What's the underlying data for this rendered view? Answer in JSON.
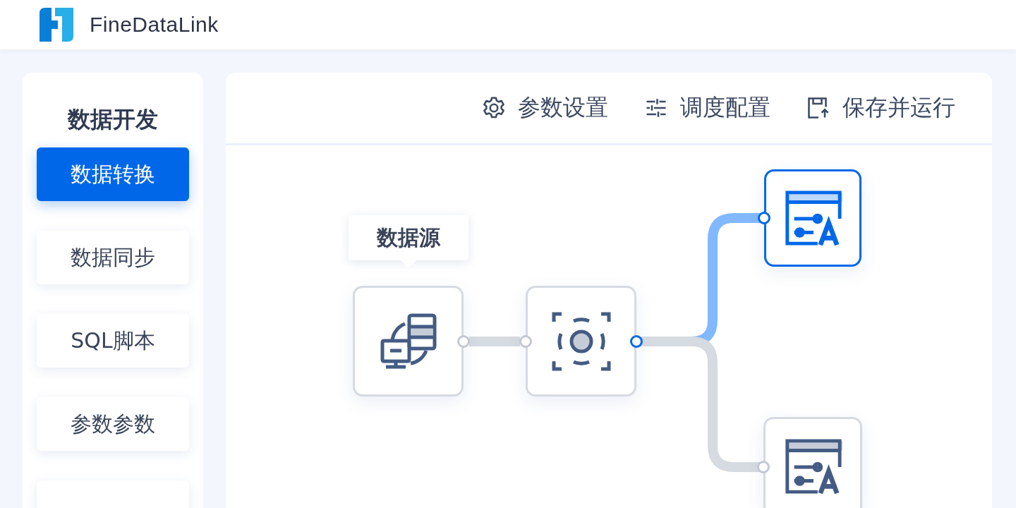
{
  "header": {
    "product_name": "FineDataLink"
  },
  "sidebar": {
    "title": "数据开发",
    "items": [
      {
        "label": "数据转换",
        "selected": true
      },
      {
        "label": "数据同步",
        "selected": false
      },
      {
        "label": "SQL脚本",
        "selected": false
      },
      {
        "label": "参数参数",
        "selected": false
      },
      {
        "selected": false
      }
    ]
  },
  "toolbar": {
    "buttons": [
      {
        "kind": "settings",
        "label": "参数设置"
      },
      {
        "kind": "schedule",
        "label": "调度配置"
      },
      {
        "kind": "save",
        "label": "保存并运行"
      }
    ]
  },
  "canvas": {
    "tooltip": "数据源",
    "nodes": [
      {
        "kind": "source",
        "selected": false
      },
      {
        "kind": "transform",
        "selected": false
      },
      {
        "kind": "output",
        "selected": true
      },
      {
        "kind": "output",
        "selected": false
      }
    ],
    "edges": [
      {
        "active": false
      },
      {
        "active": true
      },
      {
        "active": false
      }
    ]
  }
}
